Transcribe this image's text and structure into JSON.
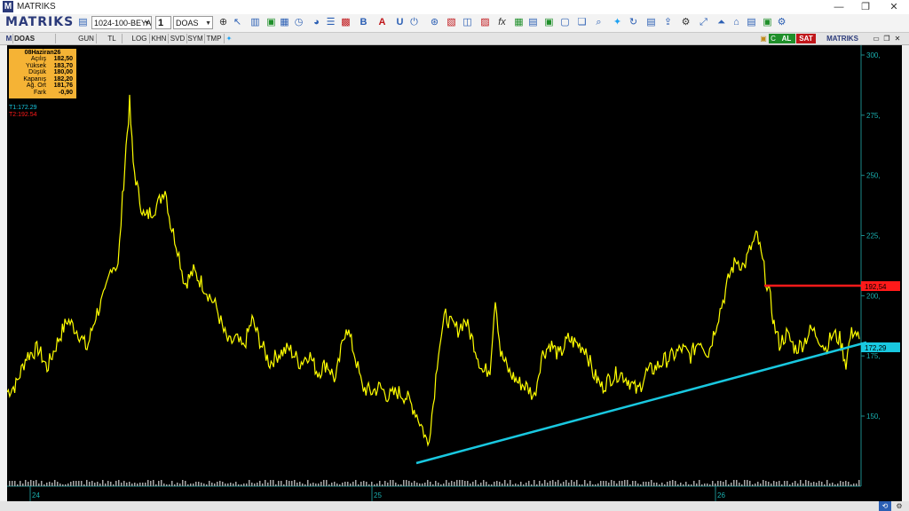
{
  "window": {
    "title": "MATRIKS",
    "minimize": "—",
    "maximize": "❐",
    "close": "✕"
  },
  "toolbar": {
    "brand": "MATRIKS",
    "template_combo": "1024-100-BEYA",
    "period_combo": "1",
    "symbol_combo": "DOAS"
  },
  "tabs": {
    "symbol": "DOAS",
    "items": [
      "GUN",
      "TL",
      "LOG",
      "KHN",
      "SVD",
      "SYM",
      "TMP"
    ],
    "buy": "AL",
    "sell": "SAT",
    "brand_small": "MATRIKS",
    "c_label": "C"
  },
  "info": {
    "date": "08Haziran26",
    "rows": [
      {
        "label": "Açılış",
        "value": "182,50"
      },
      {
        "label": "Yüksek",
        "value": "183,70"
      },
      {
        "label": "Düşük",
        "value": "180,00"
      },
      {
        "label": "Kapanış",
        "value": "182,20"
      },
      {
        "label": "Ağ. Ort",
        "value": "181,76"
      },
      {
        "label": "Fark",
        "value": "-0,90"
      }
    ]
  },
  "trendlines": {
    "t1": "T1:172.29",
    "t2": "T2:192.54",
    "t1_value": 172.29,
    "t2_value": 192.54,
    "t1_color": "#19c8e0",
    "t2_color": "#ff1a1a"
  },
  "chart_data": {
    "type": "line",
    "y_ticks": [
      "300,",
      "275,",
      "250,",
      "225,",
      "200,",
      "175,",
      "150,"
    ],
    "y_tick_values": [
      300,
      275,
      250,
      225,
      200,
      175,
      150
    ],
    "x_ticks": [
      "24",
      "25",
      "26"
    ],
    "price_labels": [
      "192,54",
      "172,29"
    ],
    "series_color": "#ffff00"
  }
}
